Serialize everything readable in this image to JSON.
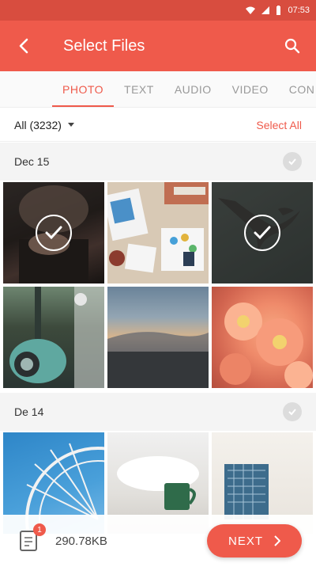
{
  "status_bar": {
    "time": "07:53",
    "icons": [
      "wifi-icon",
      "signal-icon",
      "battery-icon"
    ]
  },
  "app_bar": {
    "title": "Select Files",
    "back_icon": "back-arrow-icon",
    "search_icon": "search-icon"
  },
  "tabs": [
    {
      "label": "PHOTO",
      "active": true
    },
    {
      "label": "TEXT",
      "active": false
    },
    {
      "label": "AUDIO",
      "active": false
    },
    {
      "label": "VIDEO",
      "active": false
    },
    {
      "label": "CON",
      "active": false
    }
  ],
  "filter": {
    "selected": "All (3232)",
    "select_all": "Select All"
  },
  "sections": [
    {
      "date": "Dec 15",
      "photos": [
        {
          "name": "photo-hands",
          "selected": true
        },
        {
          "name": "photo-desk",
          "selected": false
        },
        {
          "name": "photo-bird",
          "selected": true
        },
        {
          "name": "photo-scooter",
          "selected": false
        },
        {
          "name": "photo-sky",
          "selected": false
        },
        {
          "name": "photo-flowers",
          "selected": false
        }
      ]
    },
    {
      "date": "De 14",
      "photos": [
        {
          "name": "photo-ferris-wheel",
          "selected": false
        },
        {
          "name": "photo-mug",
          "selected": false
        },
        {
          "name": "photo-building",
          "selected": false
        }
      ]
    }
  ],
  "bottom_bar": {
    "badge_count": "1",
    "total_size": "290.78KB",
    "next_label": "NEXT"
  },
  "colors": {
    "accent": "#ef5a4b",
    "status_bar": "#d84d3f"
  }
}
